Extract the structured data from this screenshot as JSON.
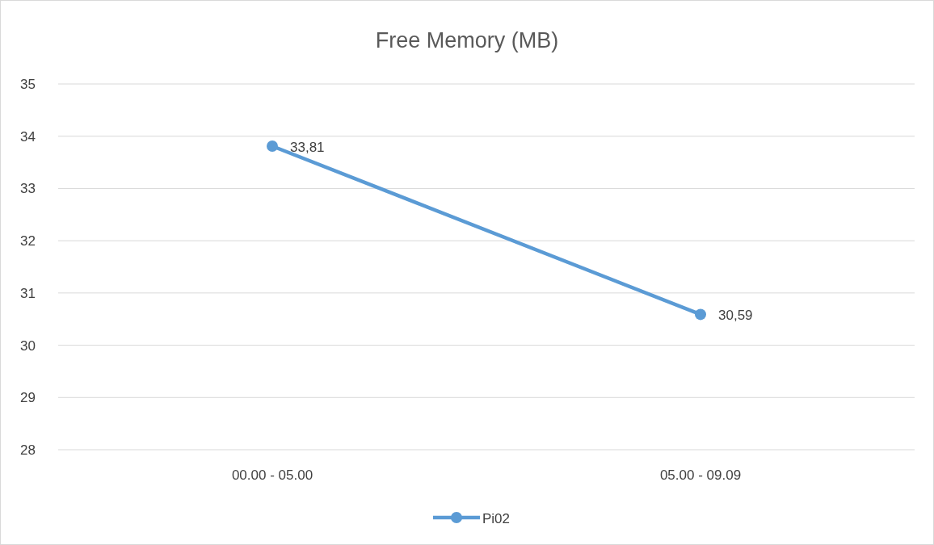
{
  "chart": {
    "chart_data": {
      "type": "line",
      "title": "Free Memory (MB)",
      "categories": [
        "00.00 - 05.00",
        "05.00 - 09.09"
      ],
      "series": [
        {
          "name": "Pi02",
          "color": "#5b9bd5",
          "values": [
            33.81,
            30.59
          ],
          "marker": "circle"
        }
      ],
      "ylim": [
        28,
        35
      ],
      "yticks": [
        28,
        29,
        30,
        31,
        32,
        33,
        34,
        35
      ],
      "grid": true,
      "value_labels": [
        "33,81",
        "30,59"
      ]
    }
  }
}
